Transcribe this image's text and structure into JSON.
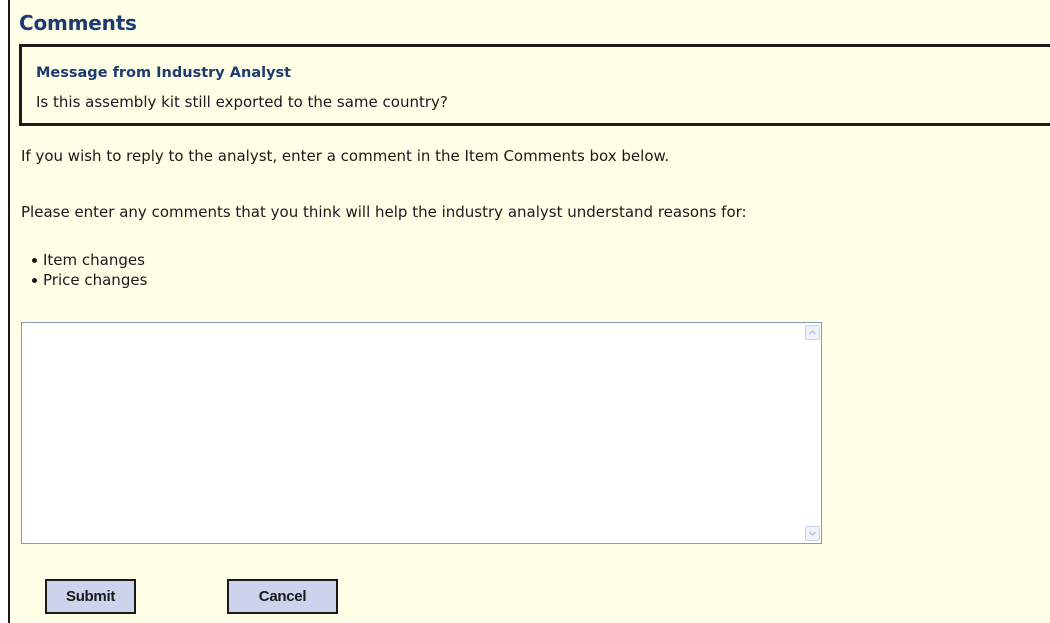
{
  "page": {
    "title": "Comments"
  },
  "message": {
    "title": "Message from Industry Analyst",
    "text": "Is this assembly kit still exported to the same country?"
  },
  "instructions": {
    "reply_hint": "If you wish to reply to the analyst, enter a comment in the Item Comments box below.",
    "intro": "Please enter any comments that you think will help the industry analyst understand reasons for:",
    "reasons": [
      "Item changes",
      "Price changes"
    ]
  },
  "comments_box": {
    "value": ""
  },
  "actions": {
    "submit_label": "Submit",
    "cancel_label": "Cancel"
  },
  "colors": {
    "background": "#ffffe8",
    "heading": "#1f3a6e",
    "button_face": "#cdd3ec",
    "textarea_border": "#7f9db9"
  },
  "icons": {
    "scroll_up": "chevron-up-icon",
    "scroll_down": "chevron-down-icon"
  }
}
